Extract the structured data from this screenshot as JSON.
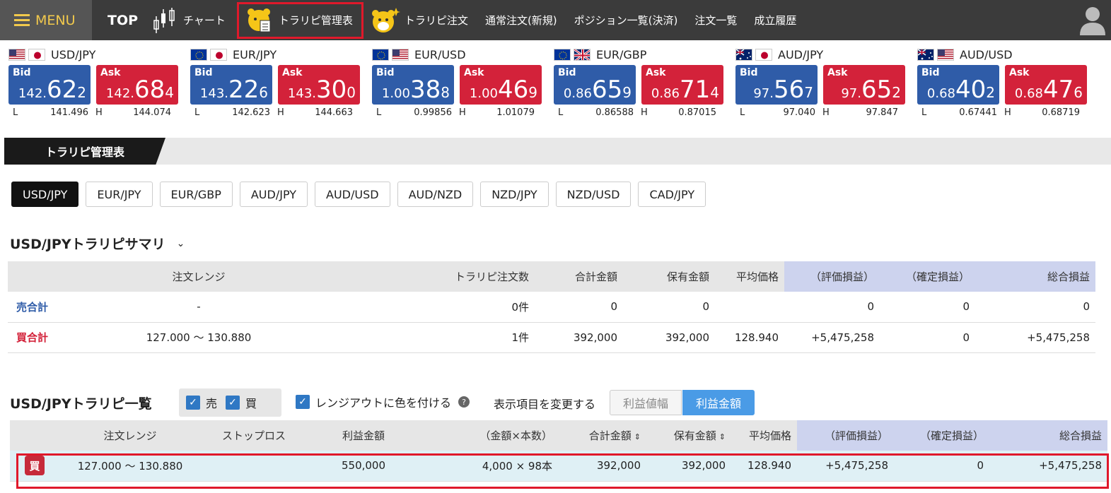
{
  "nav": {
    "menu": "MENU",
    "top": "TOP",
    "chart": "チャート",
    "manage": "トラリピ管理表",
    "order": "トラリピ注文",
    "new_order": "通常注文(新規)",
    "positions": "ポジション一覧(決済)",
    "orders": "注文一覧",
    "history": "成立履歴"
  },
  "rates": [
    {
      "pair": "USD/JPY",
      "flags": [
        "us",
        "jp"
      ],
      "bid": {
        "label": "Bid",
        "pre": "142.",
        "big": "62",
        "pip": "2"
      },
      "ask": {
        "label": "Ask",
        "pre": "142.",
        "big": "68",
        "pip": "4"
      },
      "low_label": "L",
      "low": "141.496",
      "high_label": "H",
      "high": "144.074"
    },
    {
      "pair": "EUR/JPY",
      "flags": [
        "eu",
        "jp"
      ],
      "bid": {
        "label": "Bid",
        "pre": "143.",
        "big": "22",
        "pip": "6"
      },
      "ask": {
        "label": "Ask",
        "pre": "143.",
        "big": "30",
        "pip": "0"
      },
      "low_label": "L",
      "low": "142.623",
      "high_label": "H",
      "high": "144.663"
    },
    {
      "pair": "EUR/USD",
      "flags": [
        "eu",
        "us"
      ],
      "bid": {
        "label": "Bid",
        "pre": "1.00",
        "big": "38",
        "pip": "8"
      },
      "ask": {
        "label": "Ask",
        "pre": "1.00",
        "big": "46",
        "pip": "9"
      },
      "low_label": "L",
      "low": "0.99856",
      "high_label": "H",
      "high": "1.01079"
    },
    {
      "pair": "EUR/GBP",
      "flags": [
        "eu",
        "gb"
      ],
      "bid": {
        "label": "Bid",
        "pre": "0.86",
        "big": "65",
        "pip": "9"
      },
      "ask": {
        "label": "Ask",
        "pre": "0.86",
        "big": "71",
        "pip": "4"
      },
      "low_label": "L",
      "low": "0.86588",
      "high_label": "H",
      "high": "0.87015"
    },
    {
      "pair": "AUD/JPY",
      "flags": [
        "au",
        "jp"
      ],
      "bid": {
        "label": "Bid",
        "pre": "97.",
        "big": "56",
        "pip": "7"
      },
      "ask": {
        "label": "Ask",
        "pre": "97.",
        "big": "65",
        "pip": "2"
      },
      "low_label": "L",
      "low": "97.040",
      "high_label": "H",
      "high": "97.847"
    },
    {
      "pair": "AUD/USD",
      "flags": [
        "au",
        "us"
      ],
      "bid": {
        "label": "Bid",
        "pre": "0.68",
        "big": "40",
        "pip": "2"
      },
      "ask": {
        "label": "Ask",
        "pre": "0.68",
        "big": "47",
        "pip": "6"
      },
      "low_label": "L",
      "low": "0.67441",
      "high_label": "H",
      "high": "0.68719"
    }
  ],
  "tab": {
    "active": "トラリピ管理表"
  },
  "pairs": [
    "USD/JPY",
    "EUR/JPY",
    "EUR/GBP",
    "AUD/JPY",
    "AUD/USD",
    "AUD/NZD",
    "NZD/JPY",
    "NZD/USD",
    "CAD/JPY"
  ],
  "summary": {
    "title": "USD/JPYトラリピサマリ",
    "headers": {
      "range": "注文レンジ",
      "count": "トラリピ注文数",
      "total": "合計金額",
      "held": "保有金額",
      "avg": "平均価格",
      "unreal": "（評価損益）",
      "real": "（確定損益）",
      "net": "総合損益"
    },
    "sell": {
      "label": "売合計",
      "range": "-",
      "count": "0件",
      "total": "0",
      "held": "0",
      "avg": "",
      "unreal": "0",
      "real": "0",
      "net": "0"
    },
    "buy": {
      "label": "買合計",
      "range": "127.000 〜 130.880",
      "count": "1件",
      "total": "392,000",
      "held": "392,000",
      "avg": "128.940",
      "unreal": "+5,475,258",
      "real": "0",
      "net": "+5,475,258"
    }
  },
  "list": {
    "title": "USD/JPYトラリピ一覧",
    "chk_sell": "売",
    "chk_buy": "買",
    "range_color": "レンジアウトに色を付ける",
    "help": "?",
    "change_label": "表示項目を変更する",
    "seg_width": "利益値幅",
    "seg_amount": "利益金額",
    "headers": {
      "range": "注文レンジ",
      "stop": "ストップロス",
      "profit": "利益金額",
      "qty": "（金額×本数）",
      "total": "合計金額",
      "held": "保有金額",
      "avg": "平均価格",
      "unreal": "（評価損益）",
      "real": "（確定損益）",
      "net": "総合損益"
    },
    "row": {
      "side": "買",
      "range": "127.000 〜 130.880",
      "stop": "",
      "profit": "550,000",
      "qty": "4,000 × 98本",
      "total": "392,000",
      "held": "392,000",
      "avg": "128.940",
      "unreal": "+5,475,258",
      "real": "0",
      "net": "+5,475,258"
    }
  }
}
